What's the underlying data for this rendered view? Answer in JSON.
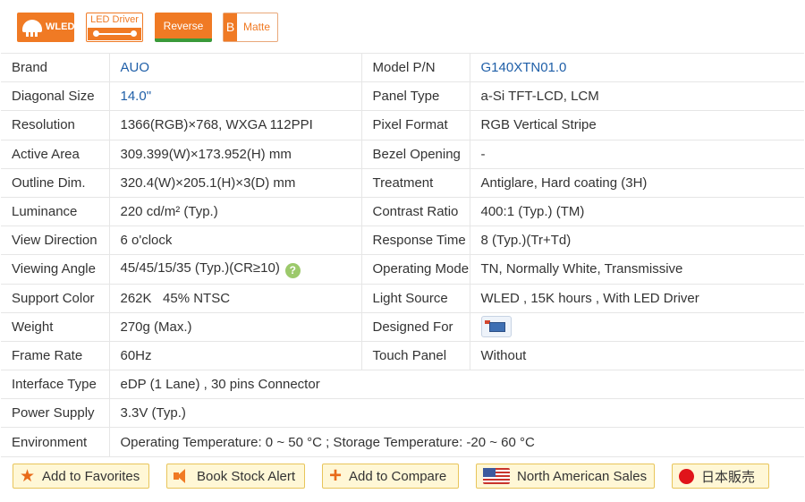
{
  "badges": {
    "wled": "WLED",
    "led_driver": "LED Driver",
    "reverse": "Reverse",
    "matte_letter": "B",
    "matte": "Matte"
  },
  "specs": {
    "brand": {
      "label": "Brand",
      "value": "AUO"
    },
    "model": {
      "label": "Model P/N",
      "value": "G140XTN01.0"
    },
    "diagonal": {
      "label": "Diagonal Size",
      "value": "14.0\""
    },
    "panel_type": {
      "label": "Panel Type",
      "value": "a-Si TFT-LCD, LCM"
    },
    "resolution": {
      "label": "Resolution",
      "value": "1366(RGB)×768, WXGA  112PPI"
    },
    "pixel_format": {
      "label": "Pixel Format",
      "value": "RGB Vertical Stripe"
    },
    "active_area": {
      "label": "Active Area",
      "value": "309.399(W)×173.952(H) mm"
    },
    "bezel": {
      "label": "Bezel Opening",
      "value": "-"
    },
    "outline": {
      "label": "Outline Dim.",
      "value": "320.4(W)×205.1(H)×3(D) mm"
    },
    "treatment": {
      "label": "Treatment",
      "value": "Antiglare, Hard coating (3H)"
    },
    "luminance": {
      "label": "Luminance",
      "value": "220 cd/m² (Typ.)"
    },
    "contrast": {
      "label": "Contrast Ratio",
      "value": "400:1 (Typ.) (TM)"
    },
    "view_direction": {
      "label": "View Direction",
      "value": "6 o'clock"
    },
    "response": {
      "label": "Response Time",
      "value": "8 (Typ.)(Tr+Td)"
    },
    "viewing_angle": {
      "label": "Viewing Angle",
      "value": "45/45/15/35 (Typ.)(CR≥10)"
    },
    "operating_mode": {
      "label": "Operating Mode",
      "value": "TN, Normally White, Transmissive"
    },
    "support_color": {
      "label": "Support Color",
      "value": "262K   45% NTSC"
    },
    "light_source": {
      "label": "Light Source",
      "value": "WLED , 15K hours , With LED Driver"
    },
    "weight": {
      "label": "Weight",
      "value": "270g (Max.)"
    },
    "designed_for": {
      "label": "Designed For"
    },
    "frame_rate": {
      "label": "Frame Rate",
      "value": "60Hz"
    },
    "touch_panel": {
      "label": "Touch Panel",
      "value": "Without"
    },
    "interface": {
      "label": "Interface Type",
      "value": "eDP (1 Lane) , 30 pins Connector"
    },
    "power": {
      "label": "Power Supply",
      "value": "3.3V (Typ.)"
    },
    "environment": {
      "label": "Environment",
      "value": "Operating Temperature: 0 ~ 50 °C ; Storage Temperature: -20 ~ 60 °C"
    }
  },
  "help_glyph": "?",
  "actions": {
    "favorites": "Add to Favorites",
    "stock_alert": "Book Stock Alert",
    "compare": "Add to Compare",
    "na_sales": "North American Sales",
    "japan": "日本販売"
  },
  "icons": [
    "wled-icon",
    "led-driver-icon",
    "reverse-icon",
    "matte-icon",
    "help-icon",
    "monitor-icon",
    "star-icon",
    "speaker-icon",
    "plus-icon",
    "us-flag-icon",
    "japan-flag-icon"
  ],
  "colors": {
    "accent": "#f07a24",
    "link": "#1f5fa8",
    "button_bg": "#fff7d6",
    "button_border": "#e8c55a"
  }
}
